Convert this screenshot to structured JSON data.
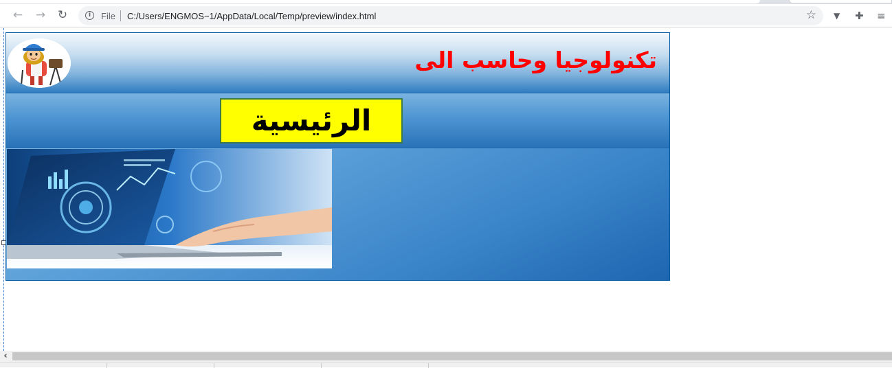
{
  "browser": {
    "back_icon": "←",
    "forward_icon": "→",
    "reload_icon": "↻",
    "info_icon": "i",
    "file_label": "File",
    "url": "C:/Users/ENGMOS~1/AppData/Local/Temp/preview/index.html",
    "star_icon": "☆",
    "extension_v_icon": "▼",
    "extension_puzzle_icon": "✚",
    "media_icon": "≡"
  },
  "page": {
    "site_title": "تكنولوجيا وحاسب الى",
    "home_button_label": "الرئيسية"
  },
  "scrollbar": {
    "left_arrow": "‹"
  },
  "colors": {
    "title": "#ff0000",
    "home_button_bg": "#ffff00",
    "header_dark": "#2f7cc0",
    "content_blue": "#3a84c9"
  }
}
